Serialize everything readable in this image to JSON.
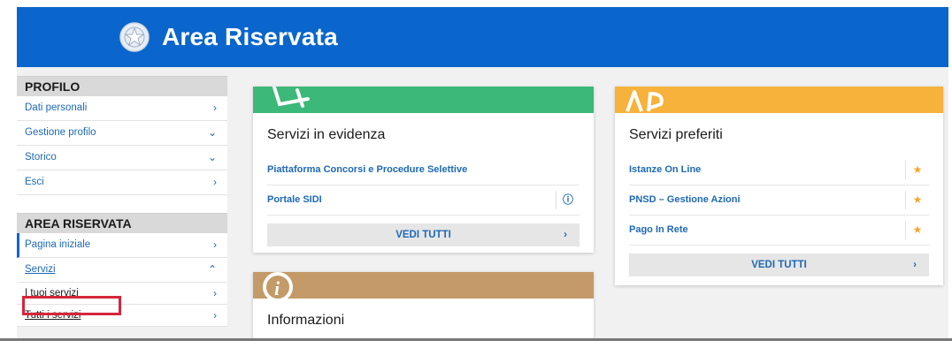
{
  "header": {
    "title": "Area Riservata",
    "emblem_icon": "repubblica-emblem"
  },
  "sidebar": {
    "profilo": {
      "title": "PROFILO",
      "items": [
        {
          "label": "Dati personali",
          "chevron": "›"
        },
        {
          "label": "Gestione profilo",
          "chevron": "⌄"
        },
        {
          "label": "Storico",
          "chevron": "⌄"
        },
        {
          "label": "Esci",
          "chevron": "›"
        }
      ]
    },
    "area": {
      "title": "AREA RISERVATA",
      "items": [
        {
          "label": "Pagina iniziale",
          "chevron": "›"
        },
        {
          "label": "Servizi",
          "chevron": "⌃"
        },
        {
          "label": "I tuoi servizi",
          "chevron": "›"
        },
        {
          "label": "Tutti i servizi",
          "chevron": "›"
        }
      ]
    }
  },
  "evidenza": {
    "title": "Servizi in evidenza",
    "band_color": "#3cb878",
    "items": [
      {
        "label": "Piattaforma Concorsi e Procedure Selettive"
      },
      {
        "label": "Portale SIDI",
        "icon": "ⓘ"
      }
    ],
    "vedi": "VEDI TUTTI",
    "vedi_chev": "›"
  },
  "preferiti": {
    "title": "Servizi preferiti",
    "band_color": "#f7b23b",
    "items": [
      {
        "label": "Istanze On Line",
        "icon": "★"
      },
      {
        "label": "PNSD – Gestione Azioni",
        "icon": "★"
      },
      {
        "label": "Pago In Rete",
        "icon": "★"
      }
    ],
    "vedi": "VEDI TUTTI",
    "vedi_chev": "›"
  },
  "informazioni": {
    "title": "Informazioni",
    "band_color": "#c49a68",
    "band_icon": "i"
  },
  "colors": {
    "header_blue": "#0a66cc",
    "link_blue": "#1d69b6",
    "highlight_red": "#d6263a"
  }
}
